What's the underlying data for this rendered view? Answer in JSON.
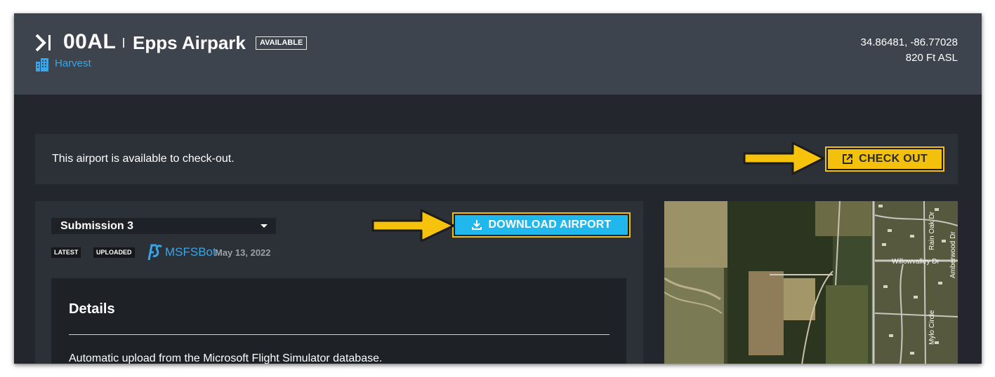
{
  "header": {
    "icao": "00AL",
    "airport_name": "Epps Airpark",
    "status_badge": "AVAILABLE",
    "developer": "Harvest",
    "coordinates": "34.86481, -86.77028",
    "elevation": "820 Ft ASL"
  },
  "checkout": {
    "message": "This airport is available to check-out.",
    "button_label": "CHECK OUT"
  },
  "submission": {
    "selected": "Submission 3",
    "download_label": "DOWNLOAD AIRPORT",
    "tags": [
      "LATEST",
      "UPLOADED"
    ],
    "uploader": "MSFSBot",
    "date": "May 13, 2022",
    "details": {
      "title": "Details",
      "text": "Automatic upload from the Microsoft Flight Simulator database."
    }
  },
  "map": {
    "street_labels": [
      "Rain Oak Dr",
      "Amberwood Dr",
      "Willowvalley Dr",
      "Mylo Circle"
    ]
  },
  "colors": {
    "accent_blue": "#1fb7ec",
    "link_blue": "#3aa6e8",
    "highlight_yellow": "#f3c10b",
    "header_bg": "#3e444d",
    "page_bg": "#23272d"
  }
}
